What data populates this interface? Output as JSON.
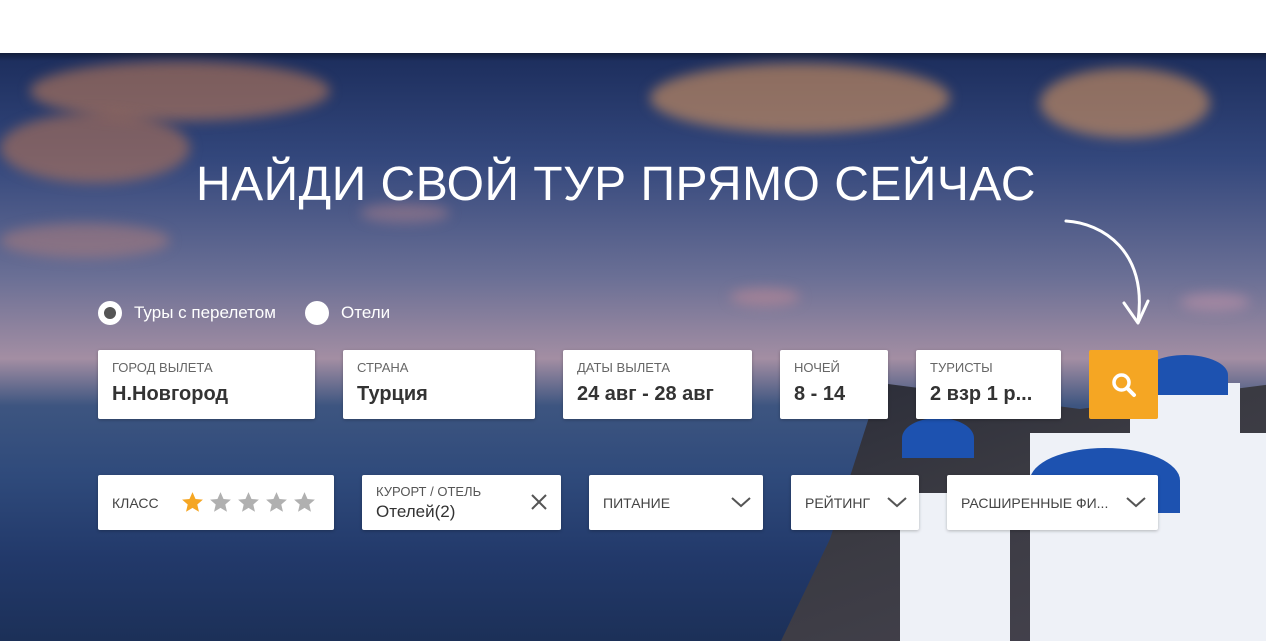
{
  "headline": "НАЙДИ СВОЙ ТУР ПРЯМО СЕЙЧАС",
  "search_type": {
    "options": [
      {
        "label": "Туры с перелетом",
        "checked": true
      },
      {
        "label": "Отели",
        "checked": false
      }
    ]
  },
  "fields": {
    "departure_city": {
      "label": "ГОРОД ВЫЛЕТА",
      "value": "Н.Новгород"
    },
    "country": {
      "label": "СТРАНА",
      "value": "Турция"
    },
    "dates": {
      "label": "ДАТЫ ВЫЛЕТА",
      "value": "24 авг - 28 авг"
    },
    "nights": {
      "label": "НОЧЕЙ",
      "value": "8 - 14"
    },
    "tourists": {
      "label": "ТУРИСТЫ",
      "value": "2 взр 1 р..."
    }
  },
  "search_button": {
    "icon": "search-icon",
    "color": "#f5a623"
  },
  "filters": {
    "class": {
      "label": "КЛАСС",
      "rating": 1,
      "max": 5,
      "active_color": "#f5a623",
      "inactive_color": "#b0b0b0"
    },
    "resort": {
      "label": "КУРОРТ / ОТЕЛЬ",
      "value": "Отелей(2)"
    },
    "food": {
      "label": "ПИТАНИЕ"
    },
    "rating": {
      "label": "РЕЙТИНГ"
    },
    "advanced": {
      "label": "РАСШИРЕННЫЕ ФИ..."
    }
  }
}
